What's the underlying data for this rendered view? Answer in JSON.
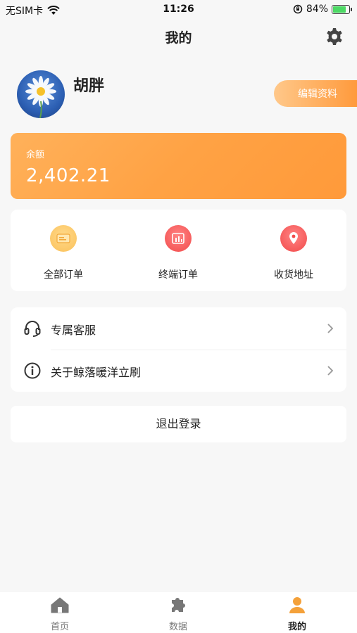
{
  "status_bar": {
    "carrier": "无SIM卡",
    "time": "11:26",
    "battery_percent": "84%",
    "battery_level": 0.84
  },
  "nav": {
    "title": "我的"
  },
  "profile": {
    "name": "胡胖",
    "edit_label": "编辑资料"
  },
  "balance": {
    "label": "余额",
    "value": "2,402.21"
  },
  "orders": [
    {
      "label": "全部订单",
      "icon": "all-orders-icon",
      "color": "#fbc15a"
    },
    {
      "label": "终端订单",
      "icon": "terminal-orders-icon",
      "color": "#f24b4b"
    },
    {
      "label": "收货地址",
      "icon": "address-icon",
      "color": "#f24b4b"
    }
  ],
  "menu": [
    {
      "label": "专属客服",
      "icon": "headset-icon"
    },
    {
      "label": "关于鲸落暖洋立刷",
      "icon": "info-icon"
    }
  ],
  "logout_label": "退出登录",
  "tabs": [
    {
      "label": "首页",
      "icon": "home-icon",
      "active": false
    },
    {
      "label": "数据",
      "icon": "puzzle-icon",
      "active": false
    },
    {
      "label": "我的",
      "icon": "user-icon",
      "active": true
    }
  ],
  "colors": {
    "accent": "#ff9f3f",
    "active_tab": "#f4a13a"
  }
}
